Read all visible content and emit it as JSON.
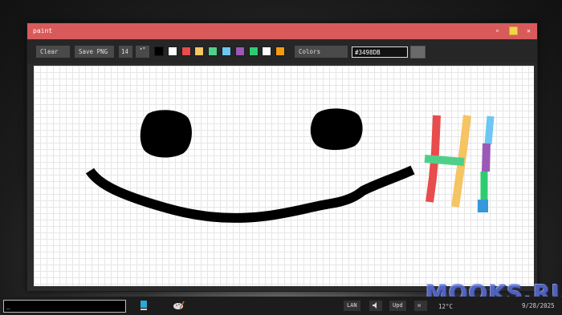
{
  "window": {
    "title": "paint",
    "option_glyph": "▫",
    "close_glyph": "✕"
  },
  "toolbar": {
    "clear_label": "Clear",
    "save_label": "Save PNG",
    "brush_size": "14",
    "stepper_glyph": "▴▾",
    "colors_label": "Colors",
    "hex_value": "#3498DB",
    "palette": [
      "#000000",
      "#ffffff",
      "#e84c4c",
      "#f5c463",
      "#4fd08a",
      "#6dc7f2",
      "#9b59b6",
      "#2ecc71",
      "#ffffff",
      "#f39c12"
    ],
    "preview_color": "#6a6a6a"
  },
  "canvas": {
    "grid": true,
    "background": "#ffffff",
    "drawing": "smiley face with colored stroke marks"
  },
  "taskbar": {
    "input_value": "_",
    "apps": [
      "terminal-icon",
      "paint-icon"
    ],
    "lan_label": "LAN",
    "volume_glyph": "🔈",
    "update_label": "Upd",
    "mail_glyph": "✉",
    "weather": "12°C",
    "date": "9/28/2025"
  },
  "watermark": "MOOKS.RU"
}
